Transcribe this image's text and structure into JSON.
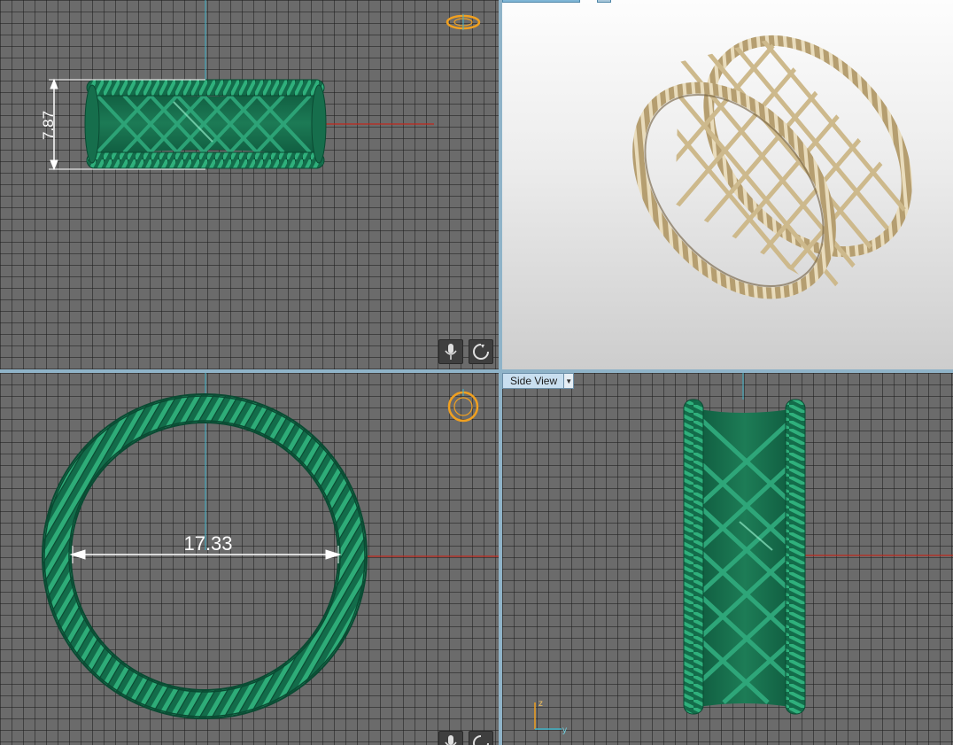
{
  "viewports": {
    "front": {
      "dimension_label": "7.87",
      "icons": [
        "ring-orientation-icon",
        "microphone-icon",
        "rotate-icon"
      ]
    },
    "perspective": {
      "tab_indicator": "active-tab-indicator"
    },
    "top": {
      "dimension_label": "17.33",
      "icons": [
        "ring-orientation-icon",
        "microphone-icon",
        "rotate-icon"
      ]
    },
    "side": {
      "view_label": "Side View",
      "axis_labels": {
        "z": "z",
        "y": "y"
      }
    }
  },
  "colors": {
    "viewport_bg": "#6b6b6b",
    "grid_line": "#1e1e1e",
    "ring_green": "#1f8a60",
    "ring_green_dark": "#0c5a3c",
    "ring_gold": "#c9b48a",
    "axis_red": "#c0281e",
    "axis_cyan": "#3fb3c8",
    "orient_icon_orange": "#f0a020",
    "frame_blue": "#8fb3c8"
  }
}
